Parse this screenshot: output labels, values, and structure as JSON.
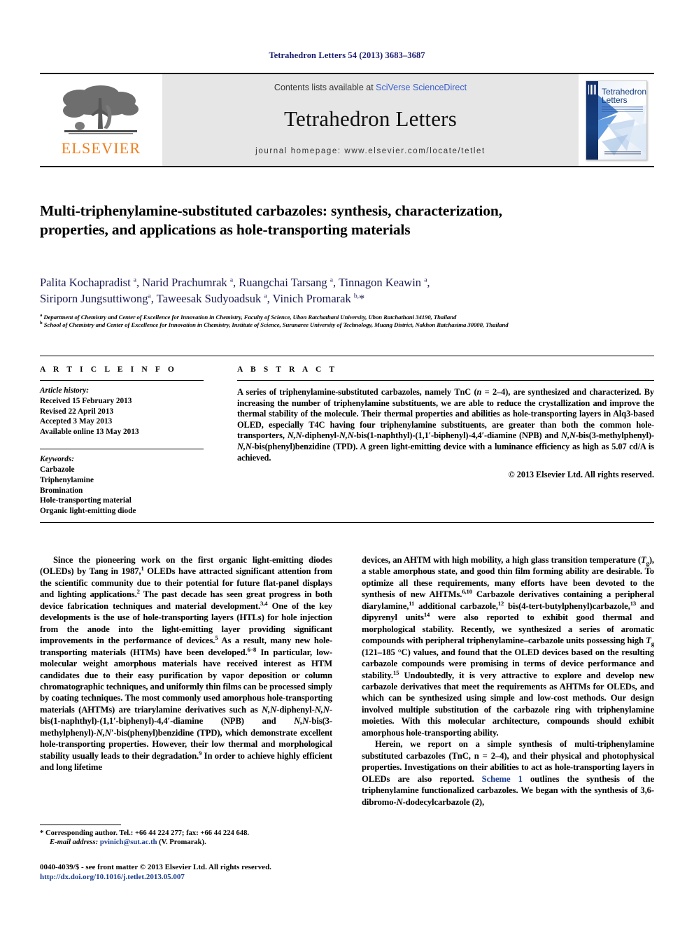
{
  "running_head": "Tetrahedron Letters 54 (2013) 3683–3687",
  "masthead": {
    "publisher_name": "ELSEVIER",
    "contents_prefix": "Contents lists available at ",
    "contents_link": "SciVerse ScienceDirect",
    "journal_title": "Tetrahedron Letters",
    "homepage": "journal homepage: www.elsevier.com/locate/tetlet",
    "cover_title_line1": "Tetrahedron",
    "cover_title_line2": "Letters"
  },
  "article": {
    "title": "Multi-triphenylamine-substituted carbazoles: synthesis, characterization, properties, and applications as hole-transporting materials",
    "authors_line1": "Palita Kochapradist a, Narid Prachumrak a, Ruangchai Tarsang a, Tinnagon Keawin a,",
    "authors_line2": "Siriporn Jungsuttiwong a, Taweesak Sudyoadsuk a, Vinich Promarak b,*",
    "affiliation_a": "Department of Chemistry and Center of Excellence for Innovation in Chemistry, Faculty of Science, Ubon Ratchathani University, Ubon Ratchathani 34190, Thailand",
    "affiliation_b": "School of Chemistry and Center of Excellence for Innovation in Chemistry, Institute of Science, Suranaree University of Technology, Muang District, Nakhon Ratchasima 30000, Thailand"
  },
  "article_info": {
    "heading": "A R T I C L E   I N F O",
    "history_label": "Article history:",
    "history": [
      "Received 15 February 2013",
      "Revised 22 April 2013",
      "Accepted 3 May 2013",
      "Available online 13 May 2013"
    ],
    "keywords_label": "Keywords:",
    "keywords": [
      "Carbazole",
      "Triphenylamine",
      "Bromination",
      "Hole-transporting material",
      "Organic light-emitting diode"
    ]
  },
  "abstract": {
    "heading": "A B S T R A C T",
    "text": "A series of triphenylamine-substituted carbazoles, namely TnC (n = 2–4), are synthesized and characterized. By increasing the number of triphenylamine substituents, we are able to reduce the crystallization and improve the thermal stability of the molecule. Their thermal properties and abilities as hole-transporting layers in Alq3-based OLED, especially T4C having four triphenylamine substituents, are greater than both the common hole-transporters, N,N-diphenyl-N,N-bis(1-naphthyl)-(1,1'-biphenyl)-4,4'-diamine (NPB) and N,N-bis(3-methylphenyl)-N,N-bis(phenyl)benzidine (TPD). A green light-emitting device with a luminance efficiency as high as 5.07 cd/A is achieved.",
    "copyright": "© 2013 Elsevier Ltd. All rights reserved."
  },
  "body": {
    "left_p1": "Since the pioneering work on the first organic light-emitting diodes (OLEDs) by Tang in 1987,1 OLEDs have attracted significant attention from the scientific community due to their potential for future flat-panel displays and lighting applications.2 The past decade has seen great progress in both device fabrication techniques and material development.3,4 One of the key developments is the use of hole-transporting layers (HTLs) for hole injection from the anode into the light-emitting layer providing significant improvements in the performance of devices.5 As a result, many new hole-transporting materials (HTMs) have been developed.6–8 In particular, low-molecular weight amorphous materials have received interest as HTM candidates due to their easy purification by vapor deposition or column chromatographic techniques, and uniformly thin films can be processed simply by coating techniques. The most commonly used amorphous hole-transporting materials (AHTMs) are triarylamine derivatives such as N,N-diphenyl-N,N-bis(1-naphthyl)-(1,1'-biphenyl)-4,4'-diamine (NPB) and N,N-bis(3-methylphenyl)-N,N'-bis(phenyl)benzidine (TPD), which demonstrate excellent hole-transporting properties. However, their low thermal and morphological stability usually leads to their degradation.9 In order to achieve highly efficient and long lifetime",
    "right_p1": "devices, an AHTM with high mobility, a high glass transition temperature (Tg), a stable amorphous state, and good thin film forming ability are desirable. To optimize all these requirements, many efforts have been devoted to the synthesis of new AHTMs.6,10 Carbazole derivatives containing a peripheral diarylamine,11 additional carbazole,12 bis(4-tert-butylphenyl)carbazole,13 and dipyrenyl units14 were also reported to exhibit good thermal and morphological stability. Recently, we synthesized a series of aromatic compounds with peripheral triphenylamine–carbazole units possessing high Tg (121–185 °C) values, and found that the OLED devices based on the resulting carbazole compounds were promising in terms of device performance and stability.15 Undoubtedly, it is very attractive to explore and develop new carbazole derivatives that meet the requirements as AHTMs for OLEDs, and which can be synthesized using simple and low-cost methods. Our design involved multiple substitution of the carbazole ring with triphenylamine moieties. With this molecular architecture, compounds should exhibit amorphous hole-transporting ability.",
    "right_p2": "Herein, we report on a simple synthesis of multi-triphenylamine substituted carbazoles (TnC, n = 2–4), and their physical and photophysical properties. Investigations on their abilities to act as hole-transporting layers in OLEDs are also reported. Scheme 1 outlines the synthesis of the triphenylamine functionalized carbazoles. We began with the synthesis of 3,6-dibromo-N-dodecylcarbazole (2),",
    "scheme_link": "Scheme 1"
  },
  "footnote": {
    "corresponding": "* Corresponding author. Tel.: +66 44 224 277; fax: +66 44 224 648.",
    "email_label": "E-mail address:",
    "email": "pvinich@sut.ac.th",
    "email_author": "(V. Promarak)."
  },
  "footer": {
    "issn_line": "0040-4039/$ - see front matter © 2013 Elsevier Ltd. All rights reserved.",
    "doi": "http://dx.doi.org/10.1016/j.tetlet.2013.05.007"
  },
  "colors": {
    "elsevier_orange": "#F07D1A",
    "link_blue": "#3a5fcd",
    "navy": "#1a1a6e",
    "masthead_gray": "#e6e6e6"
  }
}
